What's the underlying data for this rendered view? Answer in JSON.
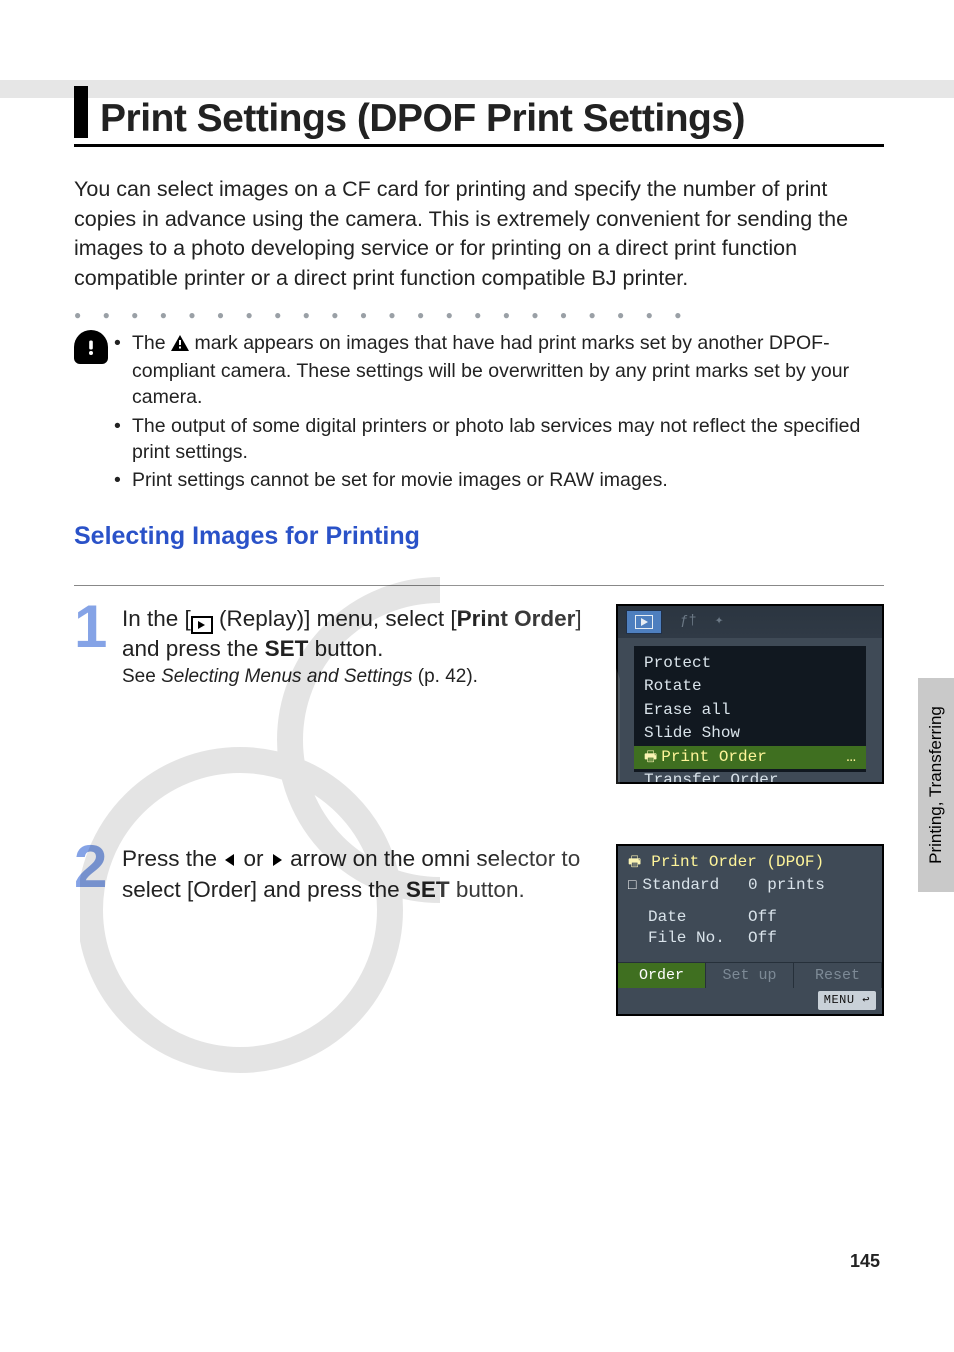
{
  "title": "Print Settings (DPOF Print Settings)",
  "intro": "You can select images on a CF card for printing and specify the number of print copies in advance using the camera. This is extremely convenient for sending the images to a photo developing service or for printing on a direct print function compatible printer or a direct print function compatible BJ printer.",
  "warnings": {
    "b1_pre": "The ",
    "b1_post": " mark appears on images that have had print marks set by another DPOF-compliant camera. These settings will be overwritten by any print marks set by your camera.",
    "b2": "The output of some digital printers or photo lab services may not reflect the specified print settings.",
    "b3": "Print settings cannot be set for movie images or RAW images."
  },
  "section_heading": "Selecting Images for Printing",
  "steps": {
    "s1": {
      "num": "1",
      "lead_a": "In the [",
      "lead_b": " (Replay)] menu, select [",
      "lead_bold1": "Print Order",
      "lead_c": "] and press the ",
      "lead_bold2": "SET",
      "lead_d": " button.",
      "sub_a": "See ",
      "sub_i": "Selecting Menus and Settings",
      "sub_b": " (p. 42)."
    },
    "s2": {
      "num": "2",
      "lead_a": "Press the ",
      "lead_b": " or ",
      "lead_c": " arrow on the omni selector to select [Order] and press the ",
      "lead_bold": "SET",
      "lead_d": " button."
    }
  },
  "cam1": {
    "items": [
      "Protect",
      "Rotate",
      "Erase all",
      "Slide Show"
    ],
    "selected": "Print Order",
    "selected_more": "…",
    "after": [
      "Transfer Order"
    ]
  },
  "cam2": {
    "title": "Print Order (DPOF)",
    "rows": [
      {
        "k": "Standard",
        "v": "0 prints",
        "std": true
      },
      {
        "k": "Date",
        "v": "Off"
      },
      {
        "k": "File No.",
        "v": "Off"
      }
    ],
    "buttons": {
      "order": "Order",
      "setup": "Set up",
      "reset": "Reset"
    },
    "menu": "MENU"
  },
  "side_tab": "Printing, Transferring",
  "page_number": "145"
}
